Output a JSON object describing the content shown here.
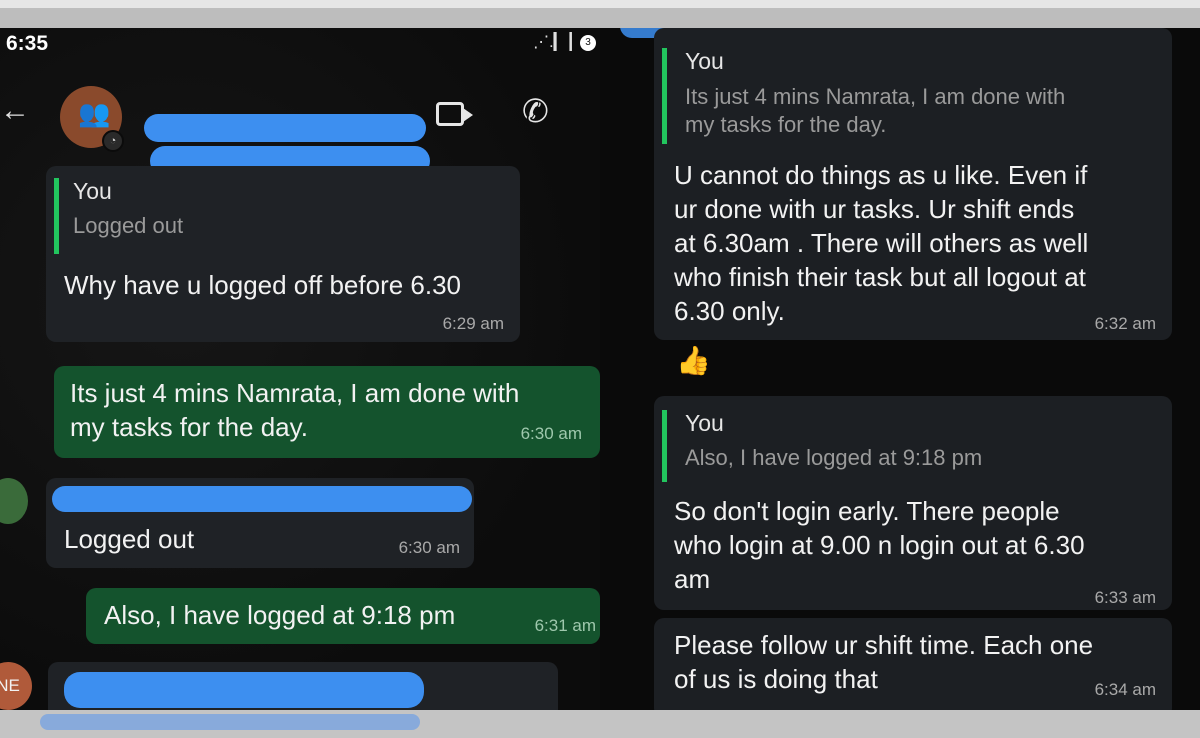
{
  "status_bar": {
    "time": "6:35",
    "signal": "⋰.▎┃",
    "battery": "3"
  },
  "header": {
    "video_icon": "video-icon",
    "phone_icon": "phone-icon",
    "back_icon": "back-arrow-icon"
  },
  "left_chat": {
    "msg1": {
      "quote_author": "You",
      "quote_text": "Logged out",
      "text": "Why have u logged off before 6.30",
      "time": "6:29 am"
    },
    "msg2": {
      "line1": "Its just 4 mins Namrata, I am done with",
      "line2": "my tasks for the day.",
      "time": "6:30 am"
    },
    "msg3": {
      "text": "Logged out",
      "time": "6:30 am"
    },
    "msg4": {
      "text": "Also, I have logged at 9:18 pm",
      "time": "6:31 am"
    },
    "avatar_initials": "NE"
  },
  "right_chat": {
    "msg1": {
      "quote_author": "You",
      "quote_line1": "Its just 4 mins Namrata, I am done with",
      "quote_line2": "my tasks for the day.",
      "line1": "U cannot do things as u like. Even if",
      "line2": "ur done with ur tasks. Ur shift ends",
      "line3": "at 6.30am . There will others as well",
      "line4": "who finish their task but all logout at",
      "line5": "6.30 only.",
      "time": "6:32 am"
    },
    "reaction": "👍",
    "msg2": {
      "quote_author": "You",
      "quote_text": "Also, I have logged at 9:18 pm",
      "line1": "So don't login early. There people",
      "line2": "who login at 9.00 n login out at 6.30",
      "line3": "am",
      "time": "6:33 am"
    },
    "msg3": {
      "line1": "Please follow ur shift time. Each one",
      "line2": "of us is doing that",
      "time": "6:34 am"
    }
  },
  "colors": {
    "incoming": "#1f2226",
    "outgoing": "#14532d",
    "quote_bar": "#22c55e",
    "redaction": "#3d8ff0"
  }
}
